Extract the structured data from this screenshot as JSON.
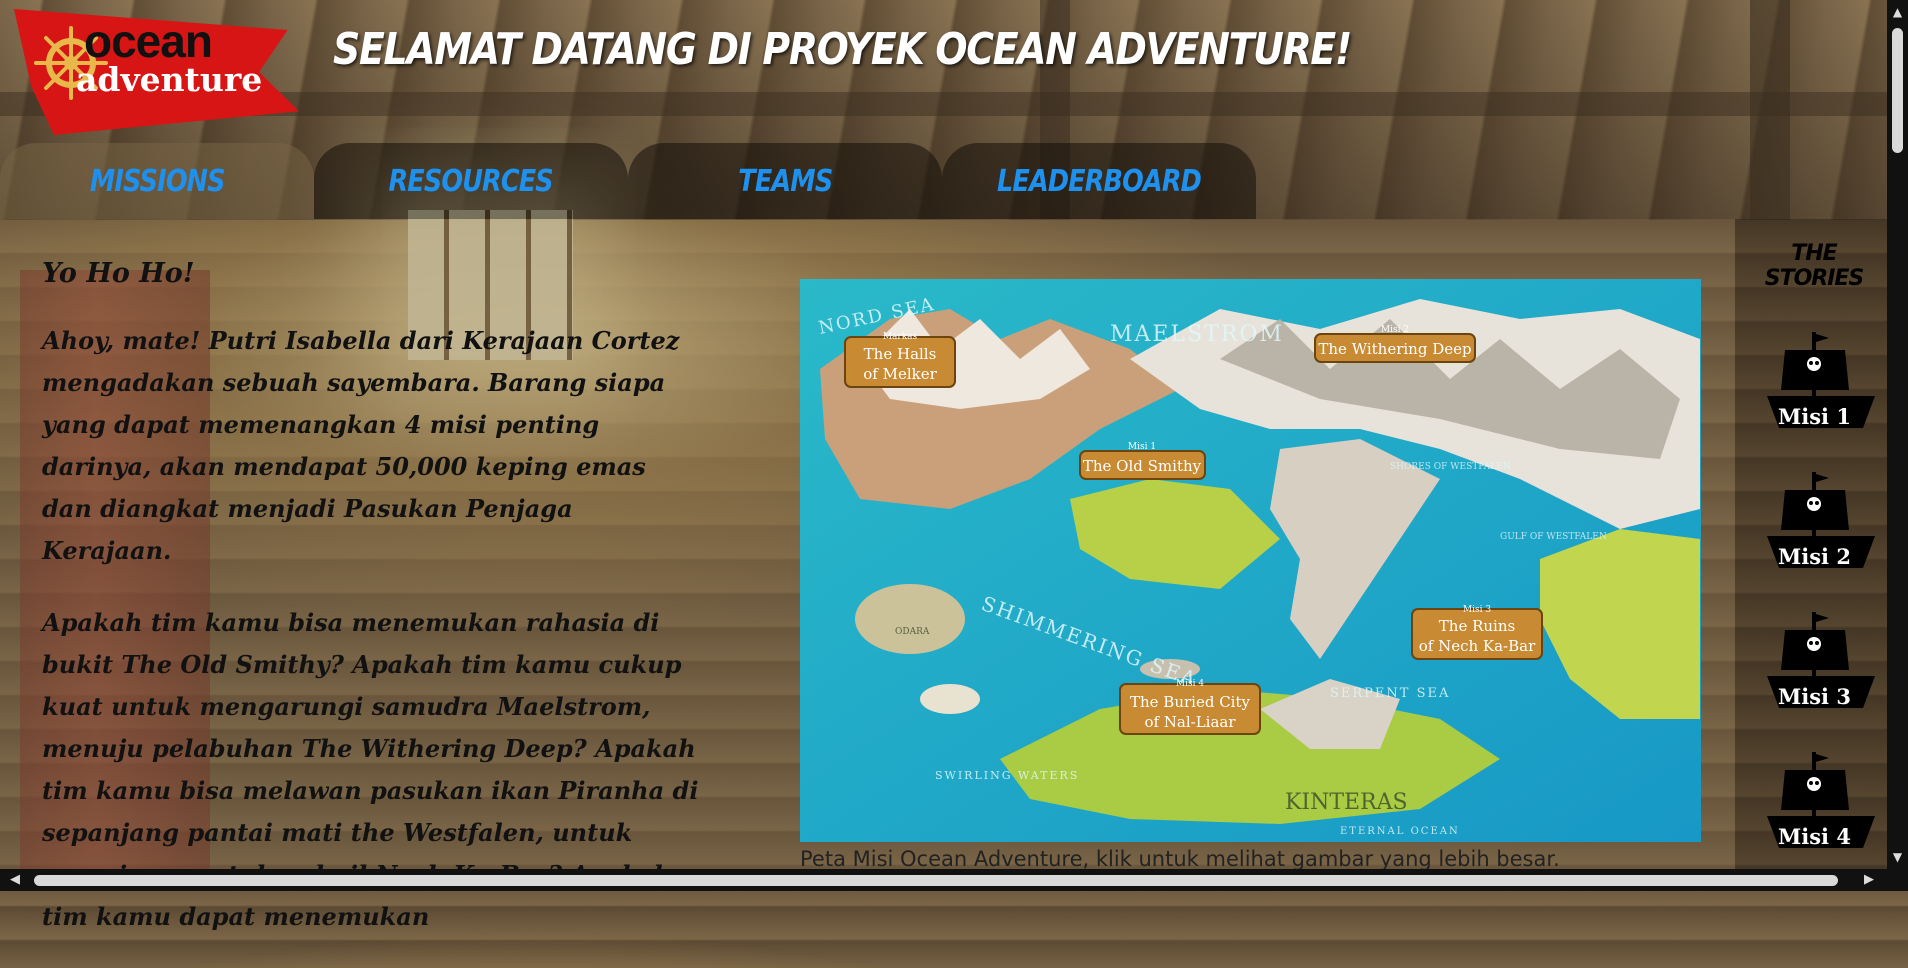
{
  "logo": {
    "word1": "ocean",
    "word2": "adventure"
  },
  "page_title": "SELAMAT DATANG DI PROYEK OCEAN ADVENTURE!",
  "tabs": [
    {
      "label": "MISSIONS"
    },
    {
      "label": "RESOURCES"
    },
    {
      "label": "TEAMS"
    },
    {
      "label": "LEADERBOARD"
    }
  ],
  "intro": {
    "heading": "Yo Ho Ho!",
    "paragraph1": "Ahoy, mate! Putri Isabella dari Kerajaan Cortez mengadakan sebuah sayembara. Barang siapa yang dapat memenangkan 4 misi penting darinya, akan mendapat 50,000 keping emas dan diangkat menjadi Pasukan Penjaga Kerajaan.",
    "paragraph2": "Apakah tim kamu bisa menemukan rahasia di bukit The Old Smithy? Apakah tim kamu cukup kuat untuk mengarungi samudra Maelstrom, menuju pelabuhan The Withering Deep? Apakah tim kamu bisa melawan pasukan ikan Piranha di sepanjang pantai mati the Westfalen, untuk menuju reruntuhan kuil Nech Ka-Bar? Apakah tim kamu dapat menemukan"
  },
  "map": {
    "caption": "Peta Misi Ocean Adventure, klik untuk melihat gambar yang lebih besar.",
    "sea_labels": [
      "NORD SEA",
      "MAELSTROM",
      "SHIMMERING SEA",
      "SERPENT SEA",
      "SWIRLING WATERS",
      "ETERNAL OCEAN"
    ],
    "banners": [
      {
        "tag": "Markas",
        "line1": "The Halls",
        "line2": "of Melker"
      },
      {
        "tag": "Misi 2",
        "line1": "The Withering Deep",
        "line2": ""
      },
      {
        "tag": "Misi 1",
        "line1": "The Old Smithy",
        "line2": ""
      },
      {
        "tag": "Misi 3",
        "line1": "The Ruins",
        "line2": "of Nech Ka-Bar"
      },
      {
        "tag": "Misi 4",
        "line1": "The Buried City",
        "line2": "of Nal-Liaar"
      }
    ],
    "land_labels": [
      "KINTERAS",
      "ODARA",
      "GULF OF WESTFALEN",
      "SHORES OF WESTFALEN"
    ]
  },
  "stories": {
    "title": "THE STORIES",
    "items": [
      {
        "label": "Misi 1"
      },
      {
        "label": "Misi 2"
      },
      {
        "label": "Misi 3"
      },
      {
        "label": "Misi 4"
      }
    ]
  },
  "colors": {
    "tab_text": "#1e90ee",
    "logo_red": "#d81515",
    "sea": "#1fb6cf"
  }
}
